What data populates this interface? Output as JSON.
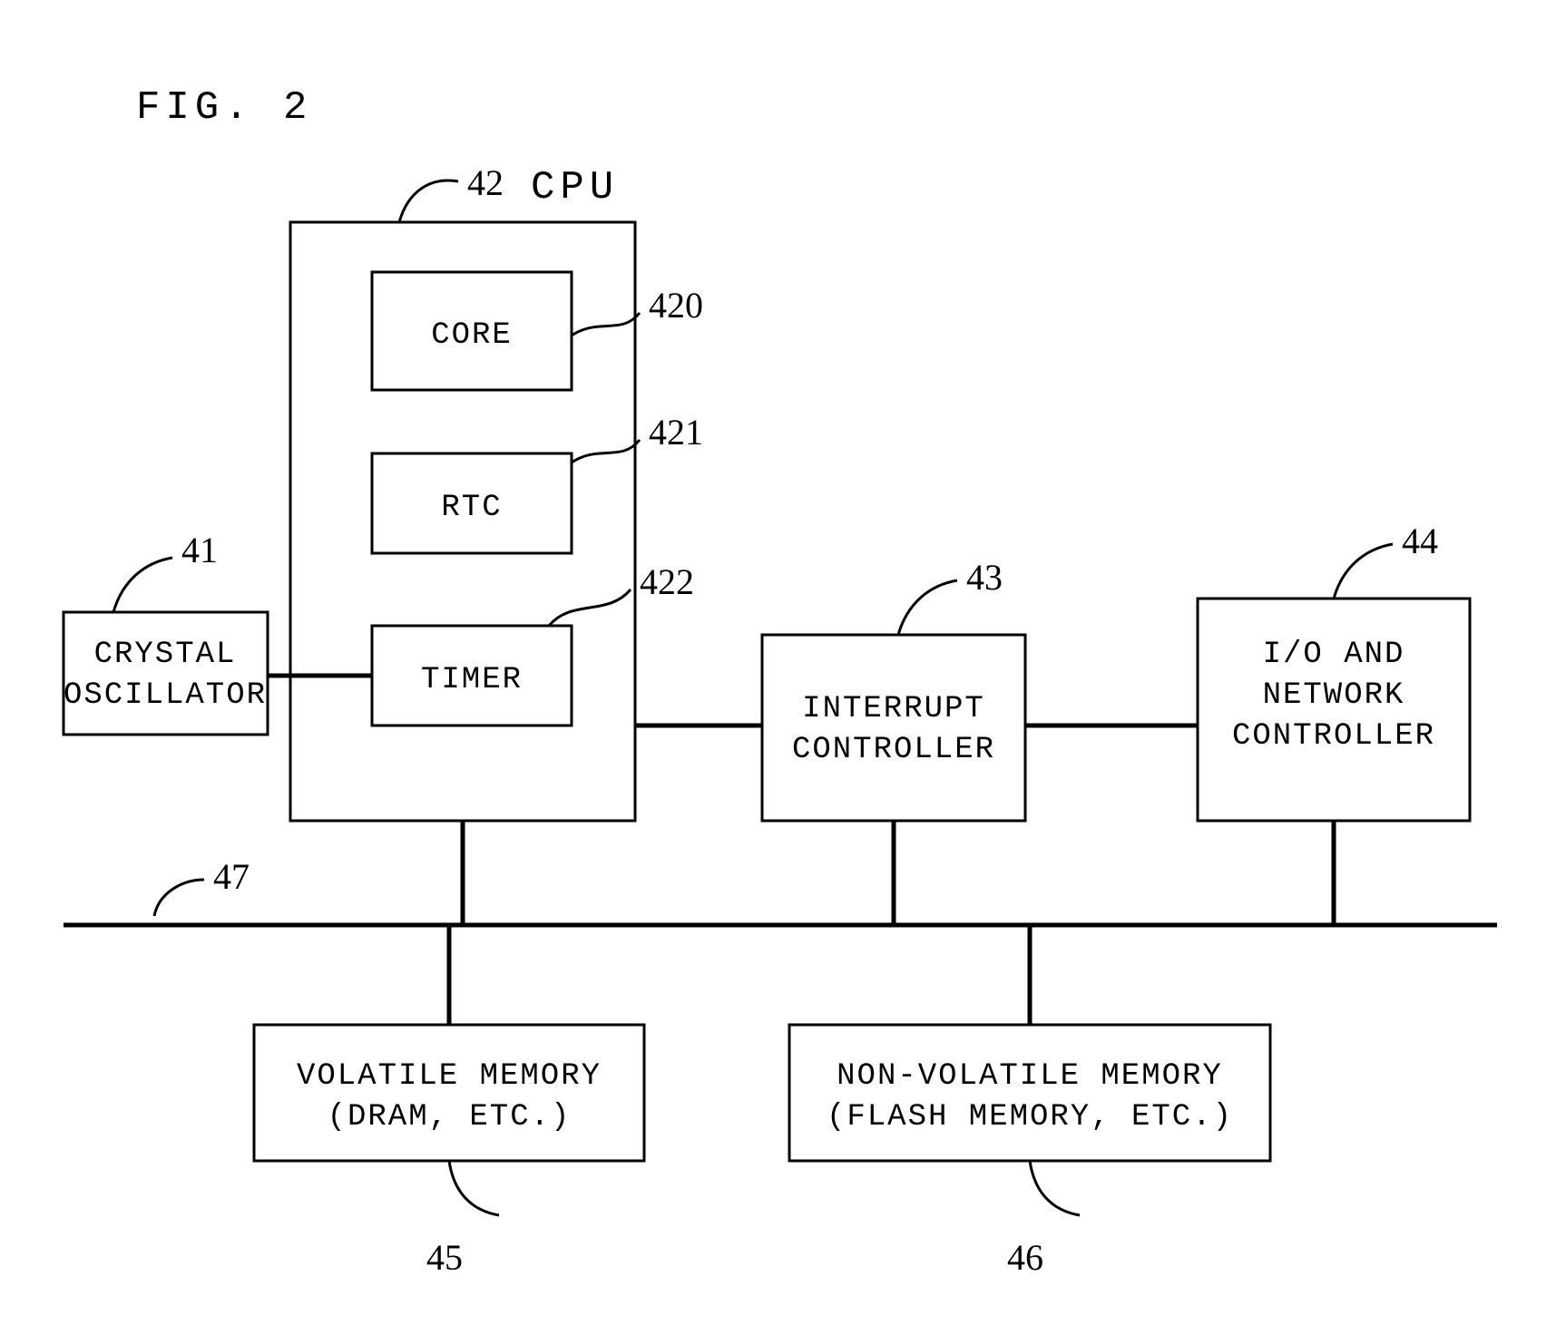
{
  "title": "FIG. 2",
  "blocks": {
    "crystal_oscillator": {
      "ref": "41",
      "line1": "CRYSTAL",
      "line2": "OSCILLATOR"
    },
    "cpu": {
      "ref": "42",
      "label": "CPU",
      "core": {
        "ref": "420",
        "label": "CORE"
      },
      "rtc": {
        "ref": "421",
        "label": "RTC"
      },
      "timer": {
        "ref": "422",
        "label": "TIMER"
      }
    },
    "interrupt_controller": {
      "ref": "43",
      "line1": "INTERRUPT",
      "line2": "CONTROLLER"
    },
    "io_network_controller": {
      "ref": "44",
      "line1": "I/O AND",
      "line2": "NETWORK",
      "line3": "CONTROLLER"
    },
    "volatile_memory": {
      "ref": "45",
      "line1": "VOLATILE MEMORY",
      "line2": "(DRAM, ETC.)"
    },
    "nonvolatile_memory": {
      "ref": "46",
      "line1": "NON-VOLATILE MEMORY",
      "line2": "(FLASH MEMORY, ETC.)"
    },
    "bus": {
      "ref": "47"
    }
  }
}
